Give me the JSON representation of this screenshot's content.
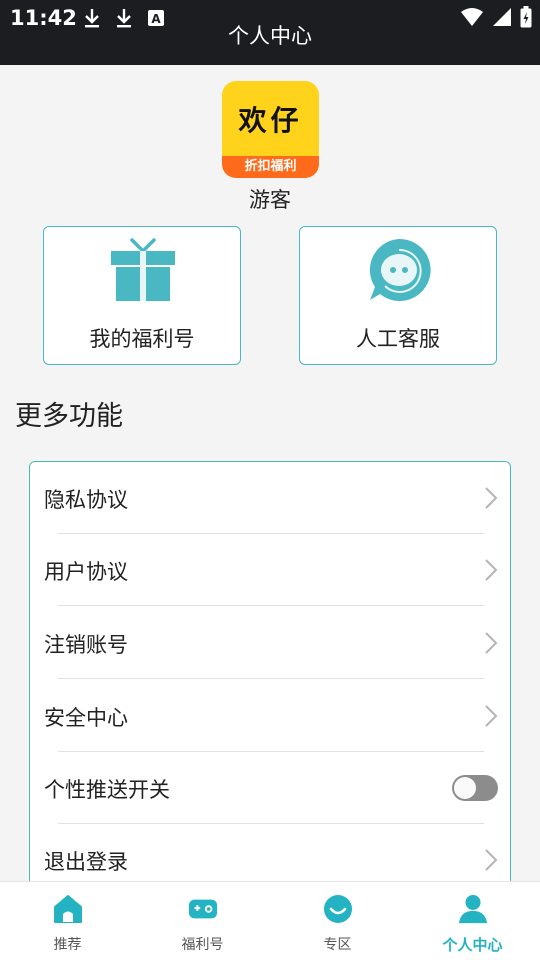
{
  "status_bar": {
    "time": "11:42",
    "left_icons": [
      "download-icon",
      "download-icon",
      "keyboard-a-icon"
    ],
    "right_icons": [
      "wifi-icon",
      "signal-icon",
      "battery-icon"
    ]
  },
  "header": {
    "title": "个人中心"
  },
  "profile": {
    "avatar_text": "欢仔",
    "avatar_banner": "折扣福利",
    "username": "游客"
  },
  "quick_cards": [
    {
      "label": "我的福利号",
      "icon": "gift-icon"
    },
    {
      "label": "人工客服",
      "icon": "chat-bubble-icon"
    }
  ],
  "more": {
    "title": "更多功能",
    "items": [
      {
        "label": "隐私协议",
        "control": "chevron"
      },
      {
        "label": "用户协议",
        "control": "chevron"
      },
      {
        "label": "注销账号",
        "control": "chevron"
      },
      {
        "label": "安全中心",
        "control": "chevron"
      },
      {
        "label": "个性推送开关",
        "control": "toggle",
        "enabled": false
      },
      {
        "label": "退出登录",
        "control": "chevron"
      }
    ]
  },
  "tabbar": {
    "tabs": [
      {
        "label": "推荐",
        "icon": "home-icon"
      },
      {
        "label": "福利号",
        "icon": "gamepad-icon"
      },
      {
        "label": "专区",
        "icon": "smile-icon"
      },
      {
        "label": "个人中心",
        "icon": "person-icon"
      }
    ],
    "active_index": 3
  },
  "colors": {
    "accent": "#23b3c2",
    "card_border": "#4ab8c2",
    "status_bar": "#1b1d21",
    "avatar_yellow": "#ffd21c",
    "avatar_orange": "#ff6b1a"
  }
}
